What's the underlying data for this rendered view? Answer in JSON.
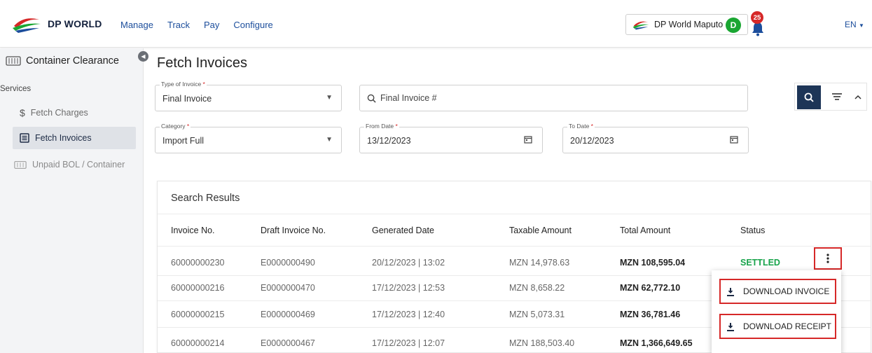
{
  "brand": {
    "name": "DP WORLD"
  },
  "nav": {
    "items": [
      "Manage",
      "Track",
      "Pay",
      "Configure"
    ]
  },
  "port": {
    "selected": "DP World Maputo"
  },
  "user": {
    "initial": "D",
    "notifications": "25",
    "language": "EN"
  },
  "sidebar": {
    "title": "Container Clearance",
    "section": "Services",
    "items": [
      {
        "label": "Fetch Charges",
        "icon": "dollar-icon"
      },
      {
        "label": "Fetch Invoices",
        "icon": "list-icon",
        "active": true
      },
      {
        "label": "Unpaid BOL / Container",
        "icon": "container-icon"
      }
    ]
  },
  "page": {
    "title": "Fetch Invoices"
  },
  "form": {
    "type_label": "Type of Invoice",
    "type_value": "Final Invoice",
    "search_placeholder": "Final Invoice #",
    "category_label": "Category",
    "category_value": "Import Full",
    "from_label": "From Date",
    "from_value": "13/12/2023",
    "to_label": "To Date",
    "to_value": "20/12/2023",
    "required_mark": "*"
  },
  "results": {
    "title": "Search Results",
    "columns": [
      "Invoice No.",
      "Draft Invoice No.",
      "Generated Date",
      "Taxable Amount",
      "Total Amount",
      "Status"
    ],
    "rows": [
      {
        "invoice": "60000000230",
        "draft": "E0000000490",
        "date": "20/12/2023 | 13:02",
        "taxable": "MZN 14,978.63",
        "total": "MZN 108,595.04",
        "status": "SETTLED"
      },
      {
        "invoice": "60000000216",
        "draft": "E0000000470",
        "date": "17/12/2023 | 12:53",
        "taxable": "MZN 8,658.22",
        "total": "MZN 62,772.10",
        "status": ""
      },
      {
        "invoice": "60000000215",
        "draft": "E0000000469",
        "date": "17/12/2023 | 12:40",
        "taxable": "MZN 5,073.31",
        "total": "MZN 36,781.46",
        "status": ""
      },
      {
        "invoice": "60000000214",
        "draft": "E0000000467",
        "date": "17/12/2023 | 12:07",
        "taxable": "MZN 188,503.40",
        "total": "MZN 1,366,649.65",
        "status": ""
      }
    ]
  },
  "menu": {
    "download_invoice": "DOWNLOAD INVOICE",
    "download_receipt": "DOWNLOAD RECEIPT"
  },
  "colors": {
    "primary": "#1d3557",
    "accent_red": "#d62828",
    "success": "#17a34a",
    "link": "#1c4e9c"
  }
}
